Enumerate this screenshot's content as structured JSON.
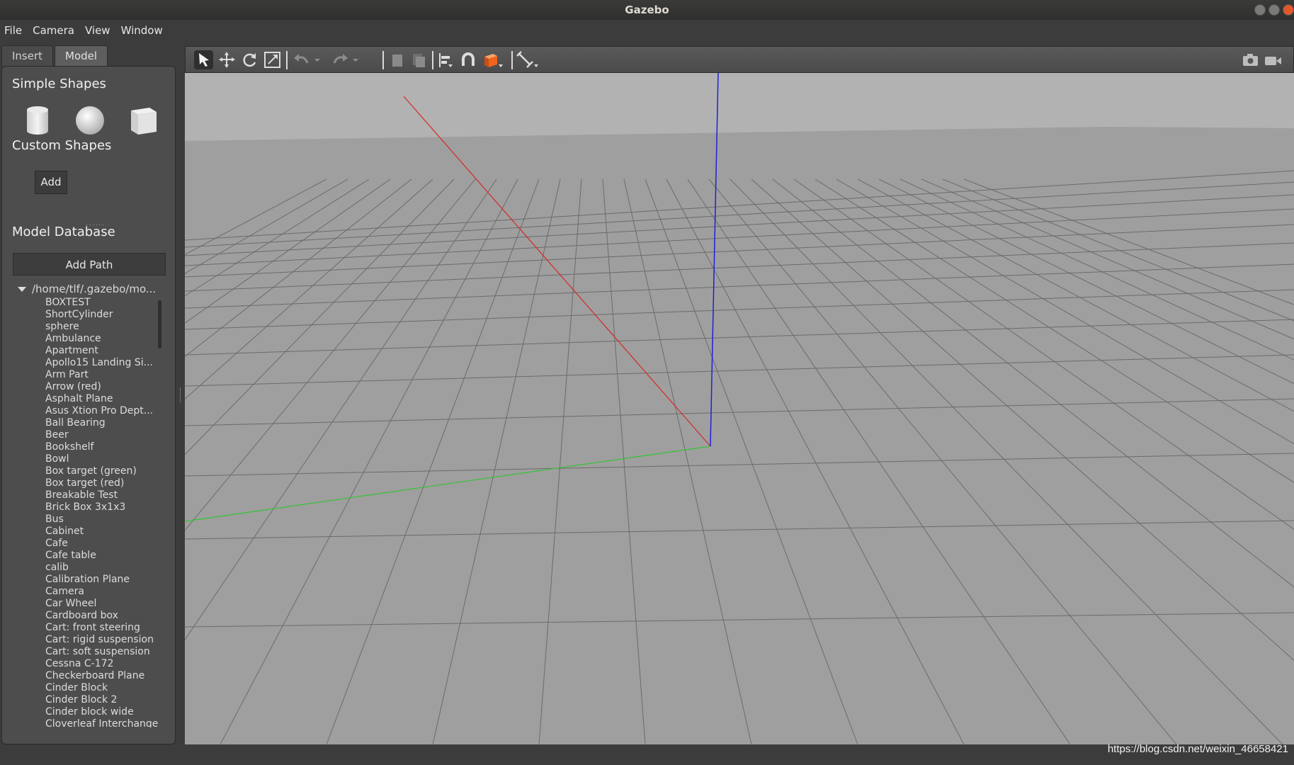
{
  "window": {
    "title": "Gazebo"
  },
  "menu": [
    {
      "label": "File"
    },
    {
      "label": "Camera"
    },
    {
      "label": "View"
    },
    {
      "label": "Window"
    }
  ],
  "tabs": [
    {
      "label": "Insert",
      "active": true
    },
    {
      "label": "Model",
      "active": false
    }
  ],
  "insert": {
    "simple_shapes_title": "Simple Shapes",
    "shapes": [
      "cylinder-icon",
      "sphere-icon",
      "box-icon"
    ],
    "custom_shapes_title": "Custom Shapes",
    "add_label": "Add",
    "model_database_title": "Model Database",
    "add_path_label": "Add Path",
    "tree_root": "/home/tlf/.gazebo/mo...",
    "models": [
      "BOXTEST",
      "ShortCylinder",
      "sphere",
      "Ambulance",
      "Apartment",
      "Apollo15 Landing Si...",
      "Arm Part",
      "Arrow (red)",
      "Asphalt Plane",
      "Asus Xtion Pro Dept...",
      "Ball Bearing",
      "Beer",
      "Bookshelf",
      "Bowl",
      "Box target (green)",
      "Box target (red)",
      "Breakable Test",
      "Brick Box 3x1x3",
      "Bus",
      "Cabinet",
      "Cafe",
      "Cafe table",
      "calib",
      "Calibration Plane",
      "Camera",
      "Car Wheel",
      "Cardboard box",
      "Cart: front steering",
      "Cart: rigid suspension",
      "Cart: soft suspension",
      "Cessna C-172",
      "Checkerboard Plane",
      "Cinder Block",
      "Cinder Block 2",
      "Cinder block wide",
      "Cloverleaf Interchange"
    ]
  },
  "toolbar": {
    "tools": [
      "select-arrow-icon",
      "translate-icon",
      "rotate-icon",
      "scale-icon",
      "undo-icon",
      "undo-dropdown-icon",
      "redo-icon",
      "redo-dropdown-icon",
      "copy-icon",
      "paste-icon",
      "align-icon",
      "snap-magnet-icon",
      "view-angle-cube-icon",
      "measure-icon",
      "screenshot-camera-icon",
      "record-video-icon"
    ]
  },
  "colors": {
    "background": "#3c3c3c",
    "panel": "#4d4d4d",
    "ground": "#9f9f9f",
    "sky": "#b2b2b2",
    "x_axis": "#d42a2a",
    "y_axis": "#33c433",
    "z_axis": "#2020d8",
    "accent_orange": "#f0641e"
  },
  "watermark": "https://blog.csdn.net/weixin_46658421"
}
